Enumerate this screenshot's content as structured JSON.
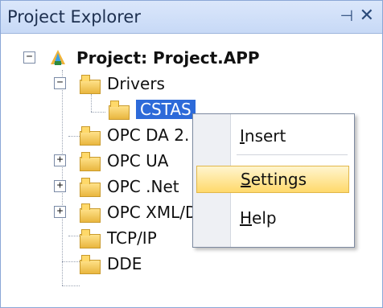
{
  "panel": {
    "title": "Project Explorer",
    "pin_glyph": "⊣",
    "close_glyph": "✕",
    "pin_icon": "pin-icon",
    "close_icon": "close-icon"
  },
  "tree": {
    "root": {
      "label": "Project: Project.APP",
      "expander": "−"
    },
    "drivers": {
      "label": "Drivers",
      "expander": "−"
    },
    "cstas": {
      "label": "CSTAS"
    },
    "items": [
      {
        "label": "OPC DA 2.",
        "expander": ""
      },
      {
        "label": "OPC UA",
        "expander": "+"
      },
      {
        "label": "OPC .Net",
        "expander": "+"
      },
      {
        "label": "OPC XML/D",
        "expander": "+"
      },
      {
        "label": "TCP/IP",
        "expander": ""
      },
      {
        "label": "DDE",
        "expander": ""
      }
    ]
  },
  "context_menu": {
    "items": [
      {
        "key": "I",
        "rest": "nsert"
      },
      {
        "key": "S",
        "rest": "ettings"
      },
      {
        "key": "H",
        "rest": "elp"
      }
    ]
  },
  "colors": {
    "selection": "#2d6ad9",
    "menu_hover": "#ffd96b",
    "title_bar": "#c7d9f6"
  }
}
